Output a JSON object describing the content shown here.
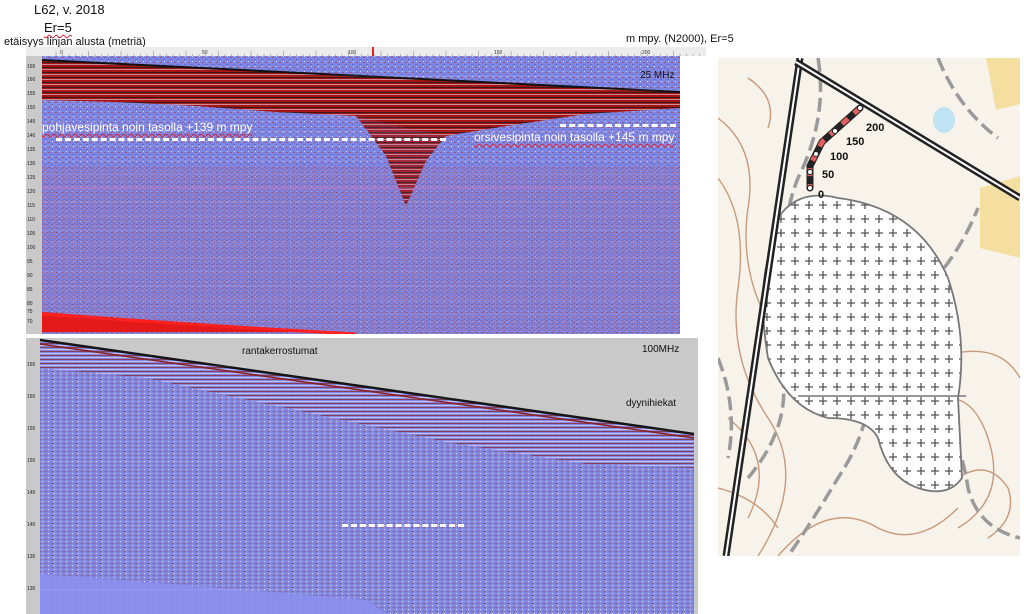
{
  "header": {
    "title": "L62, v. 2018",
    "er": "Er=5",
    "distance_label": "etäisyys linjan alusta (metriä)",
    "units_label": "m mpy. (N2000), Er=5"
  },
  "distance_ticks": [
    "0",
    "50",
    "100",
    "150",
    "200"
  ],
  "panel25": {
    "frequency": "25 MHz",
    "elevation_ticks": [
      "165",
      "160",
      "155",
      "150",
      "145",
      "140",
      "135",
      "130",
      "125",
      "120",
      "115",
      "110",
      "105",
      "100",
      "95",
      "90",
      "85",
      "80",
      "75",
      "70"
    ],
    "groundwater_label": "pohjavesipinta noin tasolla +139 m mpy",
    "perched_label": "orsivesipinta noin tasolla +145 m mpy"
  },
  "panel100": {
    "frequency": "100MHz",
    "elevation_ticks": [
      "165",
      "160",
      "155",
      "150",
      "145",
      "140",
      "135",
      "130"
    ],
    "annotation_shore": "rantakerrostumat",
    "annotation_dune": "dyynihiekat"
  },
  "map": {
    "line_distance_labels": [
      "0",
      "50",
      "100",
      "150",
      "200"
    ],
    "colors": {
      "background": "#f7f2ea",
      "contour": "#c89a7a",
      "road_dark": "#222222",
      "path_gray": "#9a9a9a",
      "wetland_cross": "#555555",
      "line_red": "#e06060",
      "field_yellow": "#f5dfa0",
      "water_blue": "#bfe3f3"
    },
    "icons": [
      "cross-hatch-icon"
    ]
  },
  "colors": {
    "radar_blue": "#7b85e6",
    "radar_red": "#b01010",
    "panel_gray": "#c8c8c8"
  }
}
